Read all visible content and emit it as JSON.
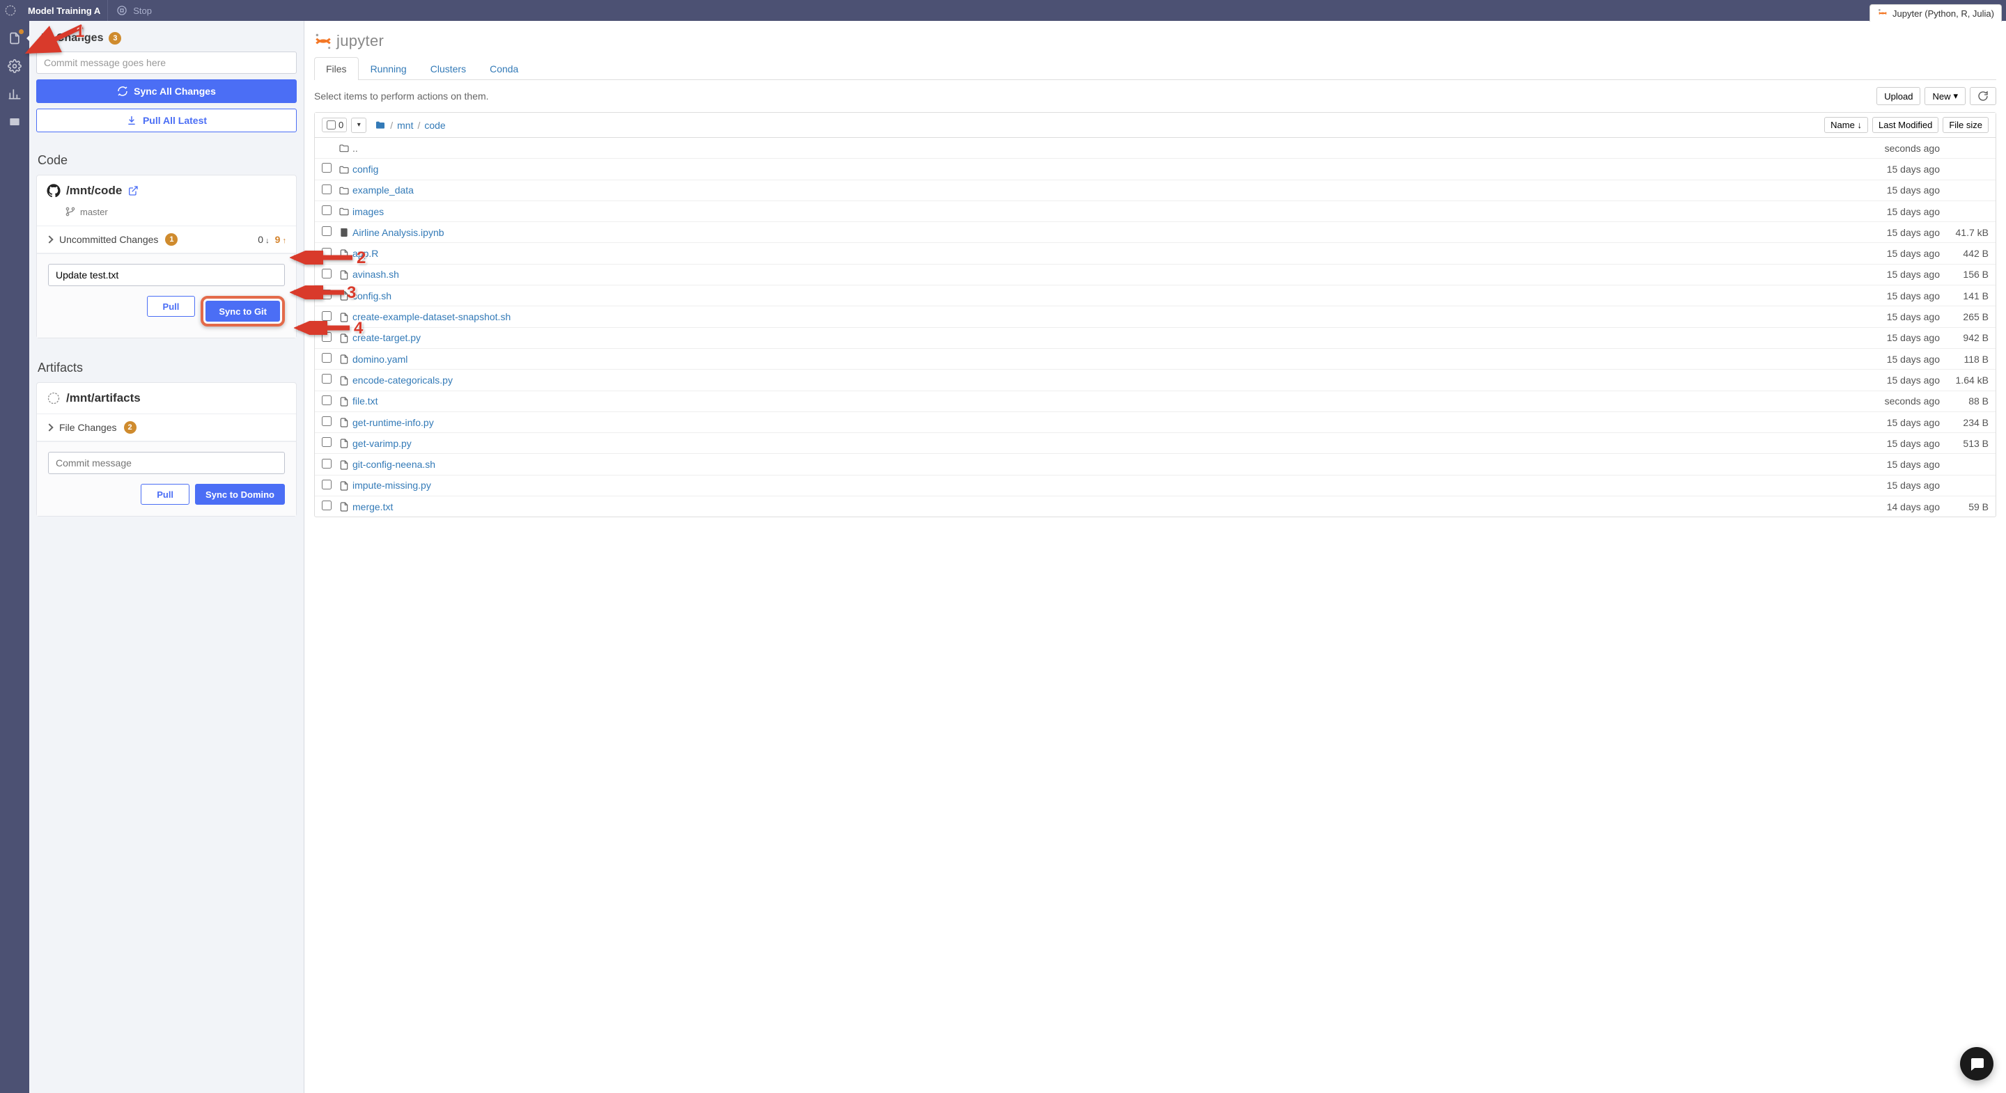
{
  "topbar": {
    "title": "Model Training A",
    "stop_label": "Stop",
    "tab_label": "Jupyter (Python, R, Julia)"
  },
  "sidebar": {
    "all_changes_title": "All Changes",
    "all_changes_badge": "3",
    "commit_placeholder": "Commit message goes here",
    "sync_all_label": "Sync All Changes",
    "pull_all_label": "Pull All Latest",
    "code_title": "Code",
    "code_path": "/mnt/code",
    "branch": "master",
    "uncommitted_label": "Uncommitted Changes",
    "uncommitted_badge": "1",
    "incoming_count": "0",
    "outgoing_count": "9",
    "commit_value": "Update test.txt",
    "pull_label": "Pull",
    "sync_git_label": "Sync to Git",
    "artifacts_title": "Artifacts",
    "artifacts_path": "/mnt/artifacts",
    "file_changes_label": "File Changes",
    "file_changes_badge": "2",
    "artifacts_commit_placeholder": "Commit message",
    "sync_domino_label": "Sync to Domino"
  },
  "jupyter": {
    "tabs": {
      "files": "Files",
      "running": "Running",
      "clusters": "Clusters",
      "conda": "Conda"
    },
    "help_text": "Select items to perform actions on them.",
    "upload_label": "Upload",
    "new_label": "New",
    "select_count": "0",
    "breadcrumb": {
      "mnt": "mnt",
      "code": "code"
    },
    "sort": {
      "name": "Name",
      "modified": "Last Modified",
      "size": "File size"
    },
    "parent_row": "..",
    "files": [
      {
        "type": "dir",
        "name": "config",
        "modified": "15 days ago",
        "size": ""
      },
      {
        "type": "dir",
        "name": "example_data",
        "modified": "15 days ago",
        "size": ""
      },
      {
        "type": "dir",
        "name": "images",
        "modified": "15 days ago",
        "size": ""
      },
      {
        "type": "nb",
        "name": "Airline Analysis.ipynb",
        "modified": "15 days ago",
        "size": "41.7 kB"
      },
      {
        "type": "file",
        "name": "app.R",
        "modified": "15 days ago",
        "size": "442 B"
      },
      {
        "type": "file",
        "name": "avinash.sh",
        "modified": "15 days ago",
        "size": "156 B"
      },
      {
        "type": "file",
        "name": "config.sh",
        "modified": "15 days ago",
        "size": "141 B"
      },
      {
        "type": "file",
        "name": "create-example-dataset-snapshot.sh",
        "modified": "15 days ago",
        "size": "265 B"
      },
      {
        "type": "file",
        "name": "create-target.py",
        "modified": "15 days ago",
        "size": "942 B"
      },
      {
        "type": "file",
        "name": "domino.yaml",
        "modified": "15 days ago",
        "size": "118 B"
      },
      {
        "type": "file",
        "name": "encode-categoricals.py",
        "modified": "15 days ago",
        "size": "1.64 kB"
      },
      {
        "type": "file",
        "name": "file.txt",
        "modified": "seconds ago",
        "size": "88 B"
      },
      {
        "type": "file",
        "name": "get-runtime-info.py",
        "modified": "15 days ago",
        "size": "234 B"
      },
      {
        "type": "file",
        "name": "get-varimp.py",
        "modified": "15 days ago",
        "size": "513 B"
      },
      {
        "type": "file",
        "name": "git-config-neena.sh",
        "modified": "15 days ago",
        "size": ""
      },
      {
        "type": "file",
        "name": "impute-missing.py",
        "modified": "15 days ago",
        "size": ""
      },
      {
        "type": "file",
        "name": "merge.txt",
        "modified": "14 days ago",
        "size": "59 B"
      }
    ]
  },
  "annotations": {
    "n1": "1",
    "n2": "2",
    "n3": "3",
    "n4": "4"
  }
}
